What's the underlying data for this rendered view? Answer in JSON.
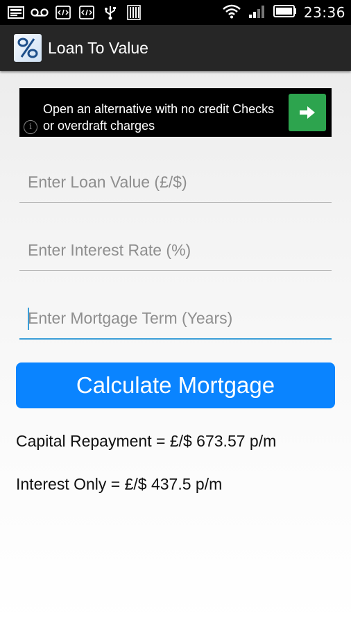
{
  "status_bar": {
    "left_icons": [
      "image-icon",
      "voicemail-icon",
      "code-icon",
      "code-icon",
      "usb-icon",
      "storage-icon"
    ],
    "right_icons": [
      "wifi-icon",
      "signal-icon",
      "battery-icon"
    ],
    "time": "23:36"
  },
  "app_bar": {
    "title": "Loan To Value",
    "icon": "percent-icon"
  },
  "ad": {
    "text": "Open an alternative with no credit Checks or overdraft charges",
    "info_icon": "info-icon",
    "action_icon": "arrow-right-icon",
    "accent_color": "#2da44e"
  },
  "form": {
    "loan_placeholder": "Enter Loan Value (£/$)",
    "interest_placeholder": "Enter Interest Rate (%)",
    "term_placeholder": "Enter Mortgage Term (Years)"
  },
  "button": {
    "label": "Calculate Mortgage",
    "color": "#0a84ff"
  },
  "results": {
    "capital_repayment": "Capital Repayment = £/$ 673.57 p/m",
    "interest_only": "Interest Only = £/$ 437.5 p/m"
  }
}
